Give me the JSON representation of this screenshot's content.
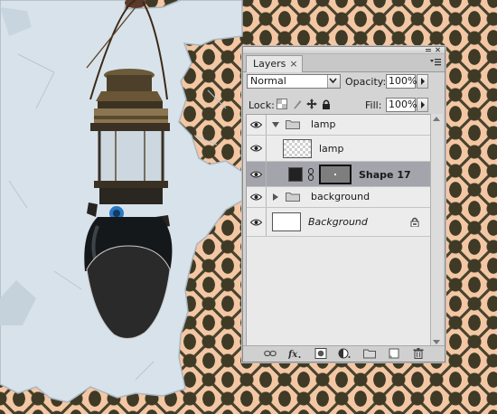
{
  "panel": {
    "tab_label": "Layers",
    "tab_close": "×",
    "blend_mode": "Normal",
    "opacity_label": "Opacity:",
    "opacity_value": "100%",
    "lock_label": "Lock:",
    "fill_label": "Fill:",
    "fill_value": "100%"
  },
  "layers": [
    {
      "name": "lamp",
      "kind": "group",
      "expanded": true,
      "visible": true
    },
    {
      "name": "lamp",
      "kind": "layer",
      "thumbnail": "transparent",
      "visible": true
    },
    {
      "name": "Shape 17",
      "kind": "shape",
      "selected": true,
      "visible": true
    },
    {
      "name": "background",
      "kind": "group",
      "expanded": false,
      "visible": true
    },
    {
      "name": "Background",
      "kind": "background",
      "italic": true,
      "locked": true,
      "visible": true
    }
  ],
  "colors": {
    "wallpaper_light": "#f4c7a4",
    "wallpaper_dark": "#3f3a26",
    "wall": "#d6e0e8",
    "panel_bg": "#d4d4d4",
    "selected_row": "#a4a4ac"
  },
  "icons": [
    "eye-icon",
    "folder-icon",
    "lock-icon",
    "link-icon",
    "fx-icon",
    "mask-icon",
    "adjustment-icon",
    "new-group-icon",
    "new-layer-icon",
    "trash-icon",
    "panel-menu-icon"
  ]
}
